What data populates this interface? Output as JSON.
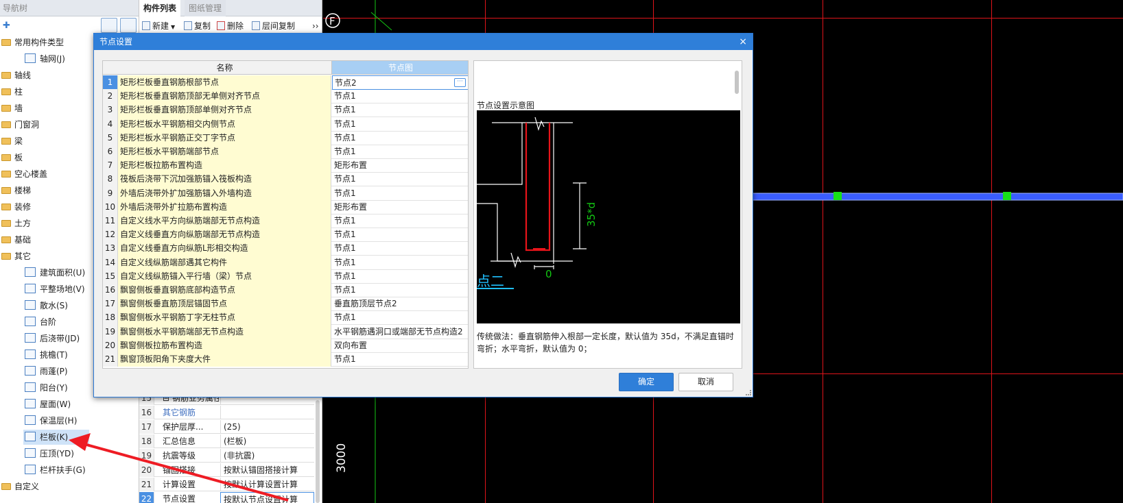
{
  "nav": {
    "title": "导航树",
    "items": [
      {
        "label": "常用构件类型",
        "type": "folder"
      },
      {
        "label": "轴网(J)",
        "type": "leaf"
      },
      {
        "label": "轴线",
        "type": "folder"
      },
      {
        "label": "柱",
        "type": "folder"
      },
      {
        "label": "墙",
        "type": "folder"
      },
      {
        "label": "门窗洞",
        "type": "folder"
      },
      {
        "label": "梁",
        "type": "folder"
      },
      {
        "label": "板",
        "type": "folder"
      },
      {
        "label": "空心楼盖",
        "type": "folder"
      },
      {
        "label": "楼梯",
        "type": "folder"
      },
      {
        "label": "装修",
        "type": "folder"
      },
      {
        "label": "土方",
        "type": "folder"
      },
      {
        "label": "基础",
        "type": "folder"
      },
      {
        "label": "其它",
        "type": "folder"
      },
      {
        "label": "建筑面积(U)",
        "type": "leaf"
      },
      {
        "label": "平整场地(V)",
        "type": "leaf"
      },
      {
        "label": "散水(S)",
        "type": "leaf"
      },
      {
        "label": "台阶",
        "type": "leaf"
      },
      {
        "label": "后浇带(JD)",
        "type": "leaf"
      },
      {
        "label": "挑檐(T)",
        "type": "leaf"
      },
      {
        "label": "雨蓬(P)",
        "type": "leaf"
      },
      {
        "label": "阳台(Y)",
        "type": "leaf"
      },
      {
        "label": "屋面(W)",
        "type": "leaf"
      },
      {
        "label": "保温层(H)",
        "type": "leaf"
      },
      {
        "label": "栏板(K)",
        "type": "leaf",
        "selected": true
      },
      {
        "label": "压顶(YD)",
        "type": "leaf"
      },
      {
        "label": "栏杆扶手(G)",
        "type": "leaf"
      },
      {
        "label": "自定义",
        "type": "folder"
      }
    ]
  },
  "mid": {
    "tab_active": "构件列表",
    "tab_inactive": "图纸管理",
    "toolbar": {
      "new": "新建",
      "copy": "复制",
      "delete": "删除",
      "floor_copy": "层间复制",
      "more": "››"
    },
    "props": [
      {
        "num": "15",
        "name": "⊟ 钢筋业务属性",
        "value": "",
        "kind": "section"
      },
      {
        "num": "16",
        "name": "其它钢筋",
        "value": "",
        "kind": "sub"
      },
      {
        "num": "17",
        "name": "保护层厚...",
        "value": "(25)",
        "kind": ""
      },
      {
        "num": "18",
        "name": "汇总信息",
        "value": "(栏板)",
        "kind": ""
      },
      {
        "num": "19",
        "name": "抗震等级",
        "value": "(非抗震)",
        "kind": ""
      },
      {
        "num": "20",
        "name": "锚固搭接",
        "value": "按默认锚固搭接计算",
        "kind": ""
      },
      {
        "num": "21",
        "name": "计算设置",
        "value": "按默认计算设置计算",
        "kind": ""
      },
      {
        "num": "22",
        "name": "节点设置",
        "value": "按默认节点设置计算",
        "kind": "highlight"
      }
    ]
  },
  "cad": {
    "dimension_text": "3000",
    "circle_label": "F"
  },
  "dialog": {
    "title": "节点设置",
    "close": "×",
    "col_name": "名称",
    "col_node": "节点图",
    "rows": [
      {
        "n": "1",
        "name": "矩形栏板垂直钢筋根部节点",
        "node": "节点2"
      },
      {
        "n": "2",
        "name": "矩形栏板垂直钢筋顶部无单侧对齐节点",
        "node": "节点1"
      },
      {
        "n": "3",
        "name": "矩形栏板垂直钢筋顶部单侧对齐节点",
        "node": "节点1"
      },
      {
        "n": "4",
        "name": "矩形栏板水平钢筋相交内侧节点",
        "node": "节点1"
      },
      {
        "n": "5",
        "name": "矩形栏板水平钢筋正交丁字节点",
        "node": "节点1"
      },
      {
        "n": "6",
        "name": "矩形栏板水平钢筋端部节点",
        "node": "节点1"
      },
      {
        "n": "7",
        "name": "矩形栏板拉筋布置构造",
        "node": "矩形布置"
      },
      {
        "n": "8",
        "name": "筏板后浇带下沉加强筋锚入筏板构造",
        "node": "节点1"
      },
      {
        "n": "9",
        "name": "外墙后浇带外扩加强筋锚入外墙构造",
        "node": "节点1"
      },
      {
        "n": "10",
        "name": "外墙后浇带外扩拉筋布置构造",
        "node": "矩形布置"
      },
      {
        "n": "11",
        "name": "自定义线水平方向纵筋端部无节点构造",
        "node": "节点1"
      },
      {
        "n": "12",
        "name": "自定义线垂直方向纵筋端部无节点构造",
        "node": "节点1"
      },
      {
        "n": "13",
        "name": "自定义线垂直方向纵筋L形相交构造",
        "node": "节点1"
      },
      {
        "n": "14",
        "name": "自定义线纵筋端部遇其它构件",
        "node": "节点1"
      },
      {
        "n": "15",
        "name": "自定义线纵筋锚入平行墙（梁）节点",
        "node": "节点1"
      },
      {
        "n": "16",
        "name": "飘窗侧板垂直钢筋底部构造节点",
        "node": "节点1"
      },
      {
        "n": "17",
        "name": "飘窗侧板垂直筋顶层锚固节点",
        "node": "垂直筋顶层节点2"
      },
      {
        "n": "18",
        "name": "飘窗侧板水平钢筋丁字无柱节点",
        "node": "节点1"
      },
      {
        "n": "19",
        "name": "飘窗侧板水平钢筋端部无节点构造",
        "node": "水平钢筋遇洞口或端部无节点构造2"
      },
      {
        "n": "20",
        "name": "飘窗侧板拉筋布置构造",
        "node": "双向布置"
      },
      {
        "n": "21",
        "name": "飘窗顶板阳角下夹度大件",
        "node": "节点1"
      }
    ],
    "preview_label": "节点设置示意图",
    "preview_text_35d": "35*d",
    "preview_text_zero": "0",
    "preview_text_node": "点二",
    "description": "传统做法：垂直钢筋伸入根部一定长度，默认值为 35d，不满足直锚时弯折；水平弯折，默认值为 0；",
    "ok": "确定",
    "cancel": "取消"
  },
  "colors": {
    "accent": "#2f7fd9",
    "grid_red": "#e0141a",
    "rebar_red": "#e8141a",
    "dimension_green": "#13c713",
    "wall_blue": "#3a5dff",
    "node_green": "#18e018",
    "name_column_bg": "#fffcd2"
  }
}
